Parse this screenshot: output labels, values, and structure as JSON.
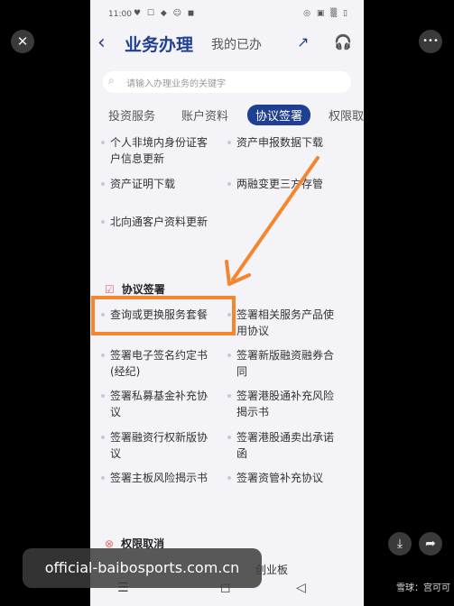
{
  "status": {
    "time": "11:00",
    "icons": "♥ ☐ ◆ ☺ ◼",
    "right": "◎ ▣ ▒ ▯"
  },
  "nav": {
    "back_icon": "‹",
    "title": "业务办理",
    "subtitle": "我的已办",
    "share_icon": "↗",
    "headset_icon": "🎧"
  },
  "search": {
    "placeholder": "请输入办理业务的关键字",
    "icon": "⌕"
  },
  "tabs": [
    {
      "label": "投资服务"
    },
    {
      "label": "账户资料"
    },
    {
      "label": "协议签署"
    },
    {
      "label": "权限取"
    }
  ],
  "account_items": {
    "l1": [
      "个人非境内身份证客",
      "户信息更新"
    ],
    "r1": "资产申报数据下载",
    "l2": "资产证明下载",
    "r2": "两融变更三方存管",
    "l3": "北向通客户资料更新"
  },
  "section_agreement": {
    "icon": "☑",
    "title": "协议签署"
  },
  "agreement_items": {
    "l1": "查询或更换服务套餐",
    "r1": [
      "签署相关服务产品使",
      "用协议"
    ],
    "l2": [
      "签署电子签名约定书",
      "(经纪)"
    ],
    "r2": [
      "签署新版融资融券合",
      "同"
    ],
    "l3": [
      "签署私募基金补充协",
      "议"
    ],
    "r3": [
      "签署港股通补充风险",
      "揭示书"
    ],
    "l4": [
      "签署融资行权新版协",
      "议"
    ],
    "r4": [
      "签署港股通卖出承诺",
      "函"
    ],
    "l5": "签署主板风险揭示书",
    "r5": "签署资管补充协议"
  },
  "section_cancel": {
    "icon": "⊗",
    "title": "权限取消"
  },
  "cancel_partial": {
    "r1": "创业板"
  },
  "watermark": "official-baibosports.com.cn",
  "bottom": {
    "menu": "☰",
    "home": "◻",
    "back": "◁"
  },
  "viewer": {
    "close_icon": "✕",
    "more_icon": "•••",
    "save_icon": "⤓",
    "share_icon": "➦",
    "credit": "雪球：宫可可"
  },
  "colors": {
    "accent": "#1f3f93",
    "highlight": "#f4862f",
    "section_icon": "#e26a63"
  }
}
